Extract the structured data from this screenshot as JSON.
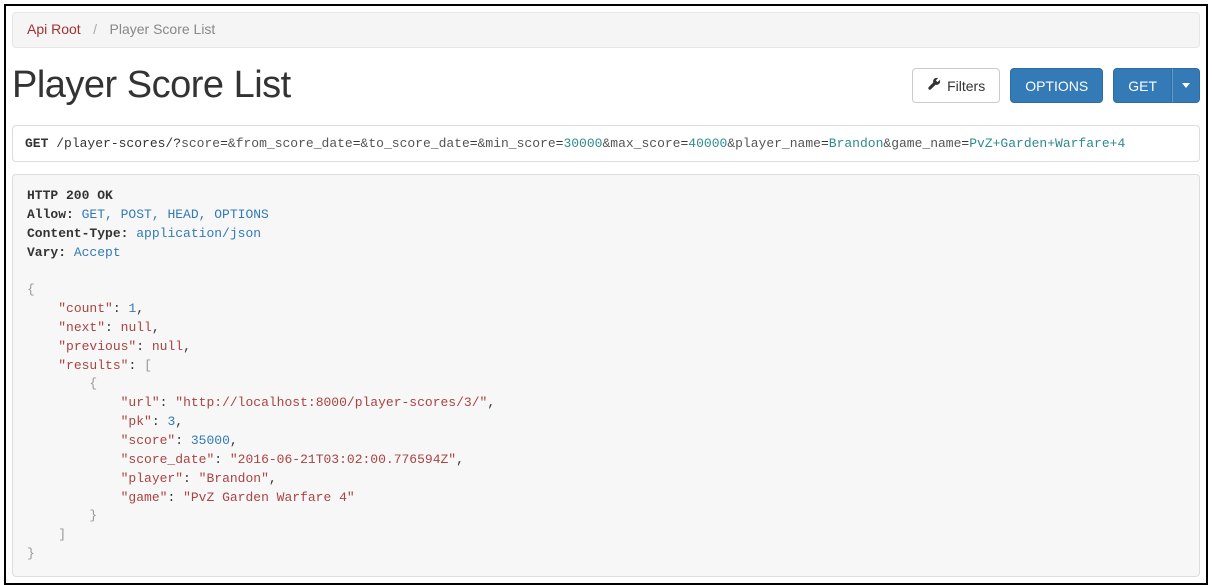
{
  "breadcrumb": {
    "root_label": "Api Root",
    "separator": "/",
    "current_label": "Player Score List"
  },
  "header": {
    "title": "Player Score List"
  },
  "buttons": {
    "filters_label": "Filters",
    "options_label": "OPTIONS",
    "get_label": "GET"
  },
  "request": {
    "method": "GET",
    "path": "/player-scores/",
    "qmark": "?",
    "params": {
      "score_key": "score",
      "score_val": "",
      "from_score_date_key": "from_score_date",
      "from_score_date_val": "",
      "to_score_date_key": "to_score_date",
      "to_score_date_val": "",
      "min_score_key": "min_score",
      "min_score_val": "30000",
      "max_score_key": "max_score",
      "max_score_val": "40000",
      "player_name_key": "player_name",
      "player_name_val": "Brandon",
      "game_name_key": "game_name",
      "game_name_val": "PvZ+Garden+Warfare+4"
    },
    "eq": "=",
    "amp": "&"
  },
  "response": {
    "status_line": "HTTP 200 OK",
    "allow_label": "Allow:",
    "allow_value": "GET, POST, HEAD, OPTIONS",
    "content_type_label": "Content-Type:",
    "content_type_value": "application/json",
    "vary_label": "Vary:",
    "vary_value": "Accept",
    "body": {
      "count_key": "\"count\"",
      "count_val": "1",
      "next_key": "\"next\"",
      "next_val": "null",
      "previous_key": "\"previous\"",
      "previous_val": "null",
      "results_key": "\"results\"",
      "url_key": "\"url\"",
      "url_val": "\"http://localhost:8000/player-scores/3/\"",
      "pk_key": "\"pk\"",
      "pk_val": "3",
      "score_key": "\"score\"",
      "score_val": "35000",
      "score_date_key": "\"score_date\"",
      "score_date_val": "\"2016-06-21T03:02:00.776594Z\"",
      "player_key": "\"player\"",
      "player_val": "\"Brandon\"",
      "game_key": "\"game\"",
      "game_val": "\"PvZ Garden Warfare 4\""
    }
  }
}
